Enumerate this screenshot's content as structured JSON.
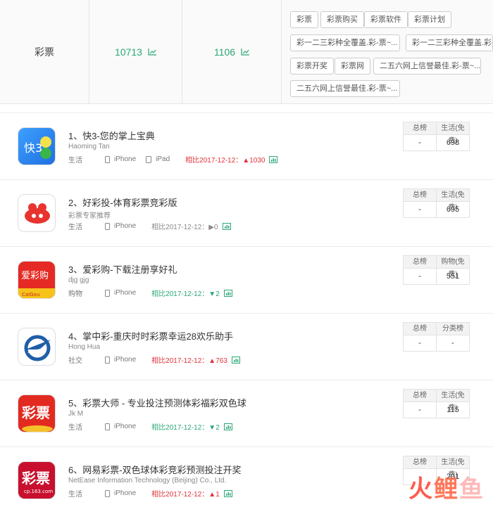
{
  "summary": {
    "keyword": "彩票",
    "search_index": "10713",
    "result_count": "1106",
    "tags": [
      "彩票",
      "彩票购买",
      "彩票软件",
      "彩票计划",
      "彩一二三彩种全覆盖.彩-票~...",
      "彩一二三彩种全覆盖.彩-票~",
      "彩票开奖",
      "彩票网",
      "二五六网上信誉最佳.彩-票~...",
      "二五六网上信誉最佳.彩-票~..."
    ]
  },
  "apps": [
    {
      "title": "1、快3-您的掌上宝典",
      "developer": "Haoming Tan",
      "category": "生活",
      "devices": [
        "iPhone",
        "iPad"
      ],
      "compare": "相比2017-12-12：▲1030",
      "trend": "up",
      "rank_head_left": "总榜",
      "rank_head_right": "生活(免费)",
      "rank_left": "-",
      "rank_right": "698",
      "icon_text": "快3"
    },
    {
      "title": "2、好彩投-体育彩票竞彩版",
      "developer": "彩票专家推荐",
      "category": "生活",
      "devices": [
        "iPhone"
      ],
      "compare": "相比2017-12-12：▶0",
      "trend": "same",
      "rank_head_left": "总榜",
      "rank_head_right": "生活(免费)",
      "rank_left": "-",
      "rank_right": "695",
      "icon_text": ""
    },
    {
      "title": "3、爱彩购-下载注册享好礼",
      "developer": "djg gjg",
      "category": "购物",
      "devices": [
        "iPhone"
      ],
      "compare": "相比2017-12-12：▼2",
      "trend": "down",
      "rank_head_left": "总榜",
      "rank_head_right": "购物(免费)",
      "rank_left": "-",
      "rank_right": "551",
      "icon_text": "爱彩购",
      "icon_sub": "CaiGou"
    },
    {
      "title": "4、掌中彩-重庆时时彩票幸运28欢乐助手",
      "developer": "Hong Hua",
      "category": "社交",
      "devices": [
        "iPhone"
      ],
      "compare": "相比2017-12-12：▲763",
      "trend": "up",
      "rank_head_left": "总榜",
      "rank_head_right": "分类榜",
      "rank_left": "-",
      "rank_right": "-",
      "icon_text": ""
    },
    {
      "title": "5、彩票大师 - 专业投注预测体彩福彩双色球",
      "developer": "Jk M",
      "category": "生活",
      "devices": [
        "iPhone"
      ],
      "compare": "相比2017-12-12：▼2",
      "trend": "down",
      "rank_head_left": "总榜",
      "rank_head_right": "生活(免费)",
      "rank_left": "-",
      "rank_right": "115",
      "icon_text": "彩票"
    },
    {
      "title": "6、网易彩票-双色球体彩竞彩预测投注开奖",
      "developer": "NetEase Information Technology (Beijing) Co., Ltd.",
      "category": "生活",
      "devices": [
        "iPhone"
      ],
      "compare": "相比2017-12-12：▲1",
      "trend": "up",
      "rank_head_left": "总榜",
      "rank_head_right": "生活(免费)",
      "rank_left": "-",
      "rank_right": "201",
      "icon_text": "彩票",
      "icon_sub": "cp.163.com"
    }
  ],
  "watermark": {
    "part1": "火",
    "part2": "鲤",
    "part3": "鱼"
  },
  "colors": {
    "green": "#2aa876",
    "red": "#e0303a",
    "border": "#e6e6e6"
  }
}
